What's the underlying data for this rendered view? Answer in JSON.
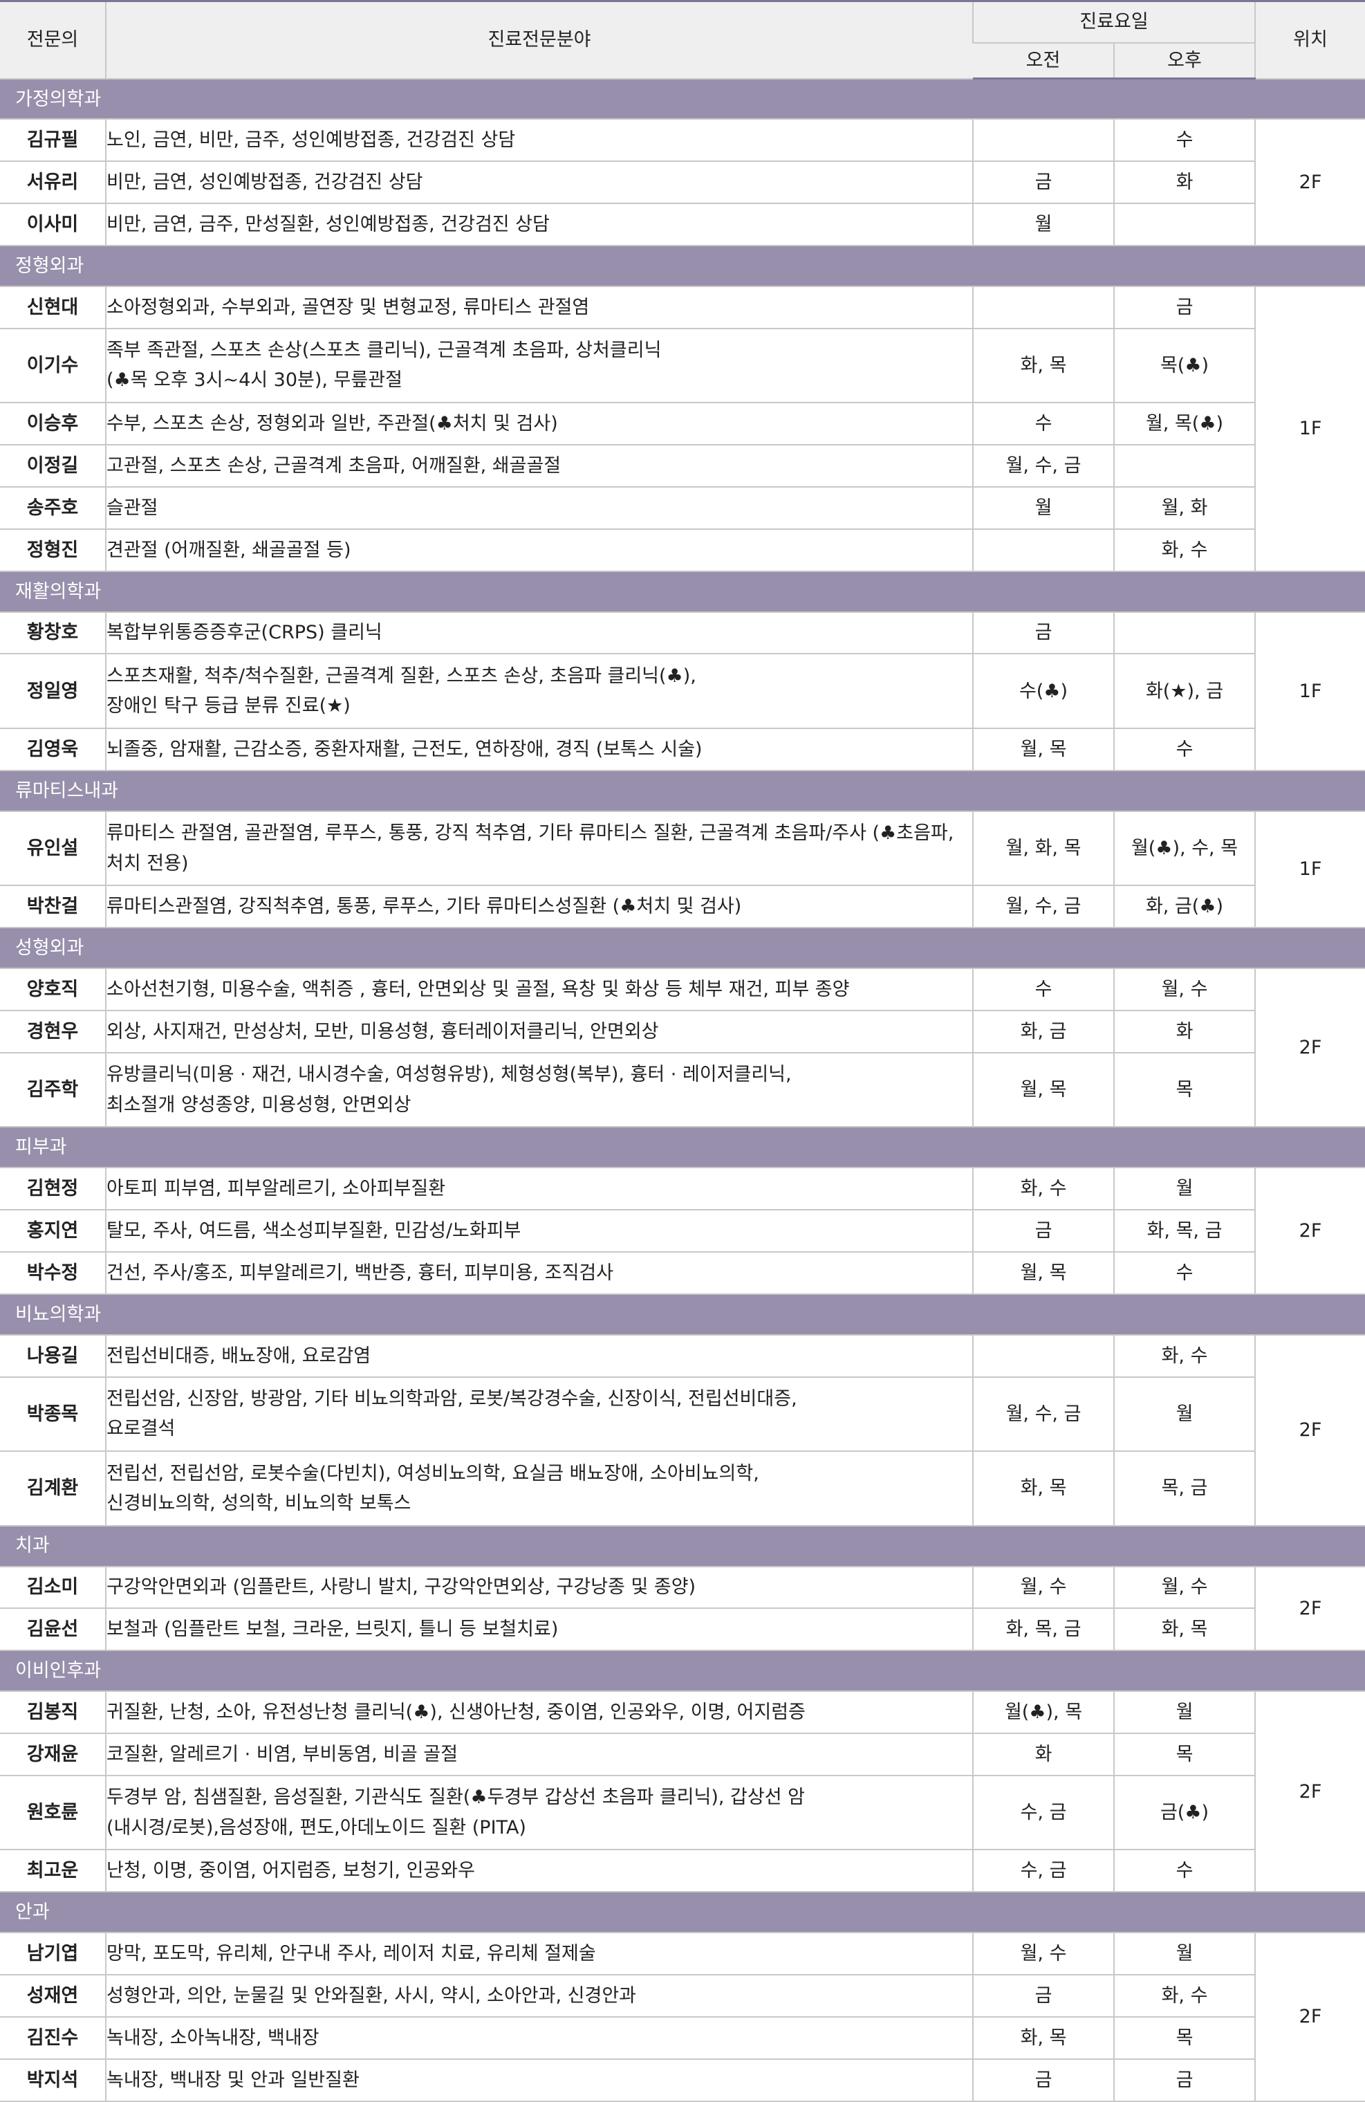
{
  "header": {
    "doctor_col": "전문의",
    "specialty_col": "진료전문분야",
    "days_col": "진료요일",
    "am_col": "오전",
    "pm_col": "오후",
    "location_col": "위치"
  },
  "departments": [
    {
      "name": "가정의학과",
      "location": "2F",
      "doctors": [
        {
          "name": "김규필",
          "specialty": "노인, 금연, 비만, 금주, 성인예방접종, 건강검진 상담",
          "am": "",
          "pm": "수"
        },
        {
          "name": "서유리",
          "specialty": "비만, 금연, 성인예방접종, 건강검진 상담",
          "am": "금",
          "pm": "화"
        },
        {
          "name": "이사미",
          "specialty": "비만, 금연, 금주, 만성질환, 성인예방접종, 건강검진 상담",
          "am": "월",
          "pm": ""
        }
      ]
    },
    {
      "name": "정형외과",
      "location": "1F",
      "doctors": [
        {
          "name": "신현대",
          "specialty": "소아정형외과, 수부외과, 골연장 및 변형교정, 류마티스 관절염",
          "am": "",
          "pm": "금"
        },
        {
          "name": "이기수",
          "specialty": "족부 족관절, 스포츠 손상(스포츠 클리닉), 근골격계 초음파, 상처클리닉\n(♣목 오후 3시~4시 30분), 무릎관절",
          "am": "화, 목",
          "pm": "목(♣)"
        },
        {
          "name": "이승후",
          "specialty": "수부, 스포츠 손상, 정형외과 일반, 주관절(♣처치 및 검사)",
          "am": "수",
          "pm": "월, 목(♣)"
        },
        {
          "name": "이정길",
          "specialty": "고관절, 스포츠 손상, 근골격계 초음파, 어깨질환, 쇄골골절",
          "am": "월, 수, 금",
          "pm": ""
        },
        {
          "name": "송주호",
          "specialty": "슬관절",
          "am": "월",
          "pm": "월, 화"
        },
        {
          "name": "정형진",
          "specialty": "견관절 (어깨질환, 쇄골골절 등)",
          "am": "",
          "pm": "화, 수"
        }
      ]
    },
    {
      "name": "재활의학과",
      "location": "1F",
      "doctors": [
        {
          "name": "황창호",
          "specialty": "복합부위통증증후군(CRPS) 클리닉",
          "am": "금",
          "pm": ""
        },
        {
          "name": "정일영",
          "specialty": "스포츠재활, 척추/척수질환, 근골격계 질환, 스포츠 손상, 초음파 클리닉(♣),\n장애인 탁구 등급 분류 진료(★)",
          "am": "수(♣)",
          "pm": "화(★), 금"
        },
        {
          "name": "김영욱",
          "specialty": "뇌졸중, 암재활, 근감소증, 중환자재활, 근전도, 연하장애, 경직 (보톡스 시술)",
          "am": "월, 목",
          "pm": "수"
        }
      ]
    },
    {
      "name": "류마티스내과",
      "location": "1F",
      "doctors": [
        {
          "name": "유인설",
          "specialty": "류마티스 관절염, 골관절염, 루푸스, 통풍, 강직 척추염, 기타 류마티스 질환, 근골격계 초음파/주사 (♣초음파,\n처치 전용)",
          "am": "월, 화, 목",
          "pm": "월(♣), 수, 목"
        },
        {
          "name": "박찬걸",
          "specialty": "류마티스관절염, 강직척추염, 통풍, 루푸스, 기타 류마티스성질환 (♣처치 및 검사)",
          "am": "월, 수, 금",
          "pm": "화, 금(♣)"
        }
      ]
    },
    {
      "name": "성형외과",
      "location": "2F",
      "doctors": [
        {
          "name": "양호직",
          "specialty": "소아선천기형, 미용수술, 액취증 , 흉터, 안면외상 및 골절, 욕창 및 화상 등 체부 재건, 피부 종양",
          "am": "수",
          "pm": "월, 수"
        },
        {
          "name": "경현우",
          "specialty": "외상, 사지재건, 만성상처, 모반, 미용성형, 흉터레이저클리닉, 안면외상",
          "am": "화, 금",
          "pm": "화"
        },
        {
          "name": "김주학",
          "specialty": "유방클리닉(미용 · 재건, 내시경수술, 여성형유방), 체형성형(복부), 흉터 · 레이저클리닉,\n최소절개 양성종양, 미용성형, 안면외상",
          "am": "월, 목",
          "pm": "목"
        }
      ]
    },
    {
      "name": "피부과",
      "location": "2F",
      "doctors": [
        {
          "name": "김현정",
          "specialty": "아토피 피부염, 피부알레르기, 소아피부질환",
          "am": "화, 수",
          "pm": "월"
        },
        {
          "name": "홍지연",
          "specialty": "탈모, 주사, 여드름, 색소성피부질환, 민감성/노화피부",
          "am": "금",
          "pm": "화, 목, 금"
        },
        {
          "name": "박수정",
          "specialty": "건선, 주사/홍조, 피부알레르기, 백반증, 흉터, 피부미용, 조직검사",
          "am": "월, 목",
          "pm": "수"
        }
      ]
    },
    {
      "name": "비뇨의학과",
      "location": "2F",
      "doctors": [
        {
          "name": "나용길",
          "specialty": "전립선비대증, 배뇨장애, 요로감염",
          "am": "",
          "pm": "화, 수"
        },
        {
          "name": "박종목",
          "specialty": "전립선암, 신장암, 방광암, 기타 비뇨의학과암, 로봇/복강경수술, 신장이식, 전립선비대증,\n요로결석",
          "am": "월, 수, 금",
          "pm": "월"
        },
        {
          "name": "김계환",
          "specialty": "전립선, 전립선암, 로봇수술(다빈치), 여성비뇨의학, 요실금 배뇨장애, 소아비뇨의학,\n신경비뇨의학, 성의학, 비뇨의학 보톡스",
          "am": "화, 목",
          "pm": "목, 금"
        }
      ]
    },
    {
      "name": "치과",
      "location": "2F",
      "doctors": [
        {
          "name": "김소미",
          "specialty": "구강악안면외과 (임플란트, 사랑니 발치, 구강악안면외상, 구강낭종 및 종양)",
          "am": "월, 수",
          "pm": "월, 수"
        },
        {
          "name": "김윤선",
          "specialty": "보철과 (임플란트 보철, 크라운, 브릿지, 틀니 등 보철치료)",
          "am": "화, 목, 금",
          "pm": "화, 목"
        }
      ]
    },
    {
      "name": "이비인후과",
      "location": "2F",
      "doctors": [
        {
          "name": "김봉직",
          "specialty": "귀질환, 난청, 소아, 유전성난청 클리닉(♣), 신생아난청, 중이염, 인공와우, 이명, 어지럼증",
          "am": "월(♣), 목",
          "pm": "월"
        },
        {
          "name": "강재윤",
          "specialty": "코질환, 알레르기 · 비염, 부비동염, 비골 골절",
          "am": "화",
          "pm": "목"
        },
        {
          "name": "원호륜",
          "specialty": "두경부 암, 침샘질환, 음성질환, 기관식도 질환(♣두경부 갑상선 초음파 클리닉), 갑상선 암\n(내시경/로봇),음성장애, 편도,아데노이드 질환 (PITA)",
          "am": "수, 금",
          "pm": "금(♣)"
        },
        {
          "name": "최고운",
          "specialty": "난청, 이명, 중이염, 어지럼증, 보청기, 인공와우",
          "am": "수, 금",
          "pm": "수"
        }
      ]
    },
    {
      "name": "안과",
      "location": "2F",
      "doctors": [
        {
          "name": "남기엽",
          "specialty": "망막, 포도막, 유리체, 안구내 주사, 레이저 치료, 유리체 절제술",
          "am": "월, 수",
          "pm": "월"
        },
        {
          "name": "성재연",
          "specialty": "성형안과, 의안, 눈물길 및 안와질환, 사시, 약시, 소아안과, 신경안과",
          "am": "금",
          "pm": "화, 수"
        },
        {
          "name": "김진수",
          "specialty": "녹내장, 소아녹내장, 백내장",
          "am": "화, 목",
          "pm": "목"
        },
        {
          "name": "박지석",
          "specialty": "녹내장, 백내장 및 안과 일반질환",
          "am": "금",
          "pm": "금"
        }
      ]
    }
  ]
}
